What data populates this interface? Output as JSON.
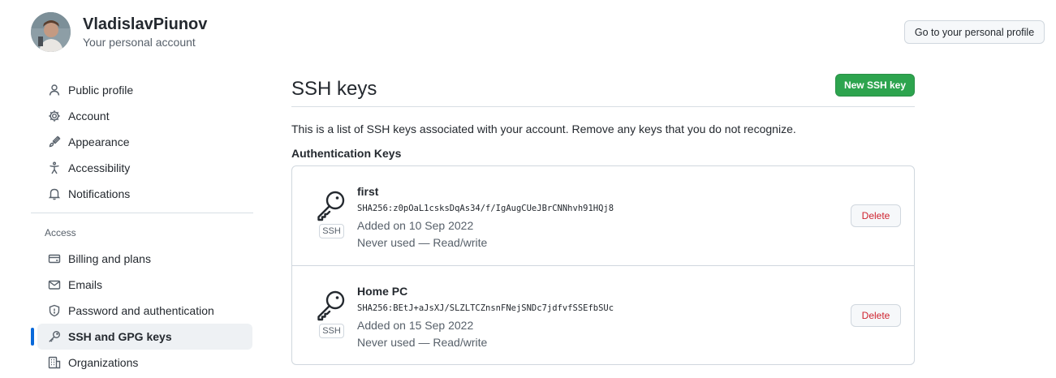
{
  "header": {
    "username": "VladislavPiunov",
    "account_type": "Your personal account",
    "profile_button": "Go to your personal profile"
  },
  "sidebar": {
    "items": [
      {
        "label": "Public profile",
        "icon": "person-icon"
      },
      {
        "label": "Account",
        "icon": "gear-icon"
      },
      {
        "label": "Appearance",
        "icon": "paintbrush-icon"
      },
      {
        "label": "Accessibility",
        "icon": "accessibility-icon"
      },
      {
        "label": "Notifications",
        "icon": "bell-icon"
      }
    ],
    "section_label": "Access",
    "access_items": [
      {
        "label": "Billing and plans",
        "icon": "credit-card-icon"
      },
      {
        "label": "Emails",
        "icon": "mail-icon"
      },
      {
        "label": "Password and authentication",
        "icon": "shield-icon"
      },
      {
        "label": "SSH and GPG keys",
        "icon": "key-icon",
        "active": true
      },
      {
        "label": "Organizations",
        "icon": "organization-icon"
      }
    ]
  },
  "main": {
    "title": "SSH keys",
    "new_key_button": "New SSH key",
    "description": "This is a list of SSH keys associated with your account. Remove any keys that you do not recognize.",
    "section_title": "Authentication Keys",
    "keys": [
      {
        "badge": "SSH",
        "name": "first",
        "fingerprint": "SHA256:z0pOaL1csksDqAs34/f/IgAugCUeJBrCNNhvh91HQj8",
        "added": "Added on 10 Sep 2022",
        "usage": "Never used — Read/write",
        "delete_label": "Delete"
      },
      {
        "badge": "SSH",
        "name": "Home PC",
        "fingerprint": "SHA256:BEtJ+aJsXJ/SLZLTCZnsnFNejSNDc7jdfvfSSEfbSUc",
        "added": "Added on 15 Sep 2022",
        "usage": "Never used — Read/write",
        "delete_label": "Delete"
      }
    ]
  },
  "colors": {
    "accent": "#0969da",
    "primary_button": "#2da44e",
    "danger": "#cf222e"
  }
}
